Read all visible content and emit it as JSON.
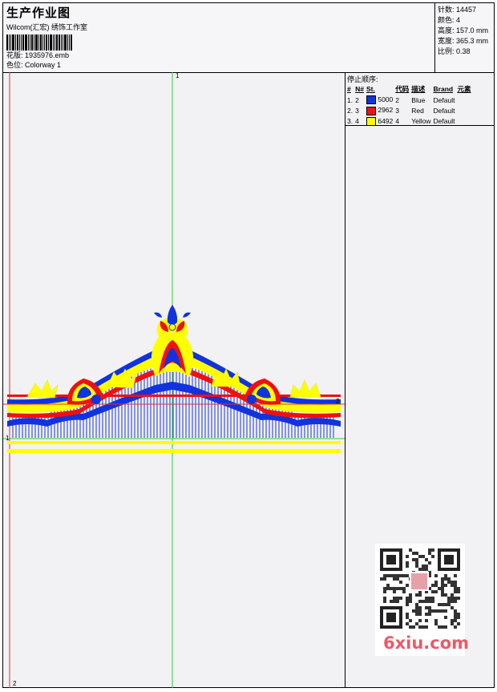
{
  "header": {
    "title": "生产作业图",
    "company": "Wilcom(汇宏) 绣饰工作室",
    "design_label": "花版: 1935976.emb",
    "colorway_label": "色位: Colorway 1"
  },
  "specs": [
    {
      "label": "针数:",
      "value": "14457"
    },
    {
      "label": "颜色:",
      "value": "4"
    },
    {
      "label": "高度:",
      "value": "157.0 mm"
    },
    {
      "label": "宽度:",
      "value": "365.3 mm"
    },
    {
      "label": "比例:",
      "value": "0.38"
    }
  ],
  "stop_sequence": {
    "title": "停止顺序:",
    "columns": [
      "#",
      "N#",
      "St.",
      "代码",
      "描述",
      "Brand",
      "元素"
    ],
    "rows": [
      {
        "num": "1.",
        "needle": "2",
        "code": "5000",
        "code_num": "2",
        "desc": "Blue",
        "brand": "Default",
        "color": "#1133dd"
      },
      {
        "num": "2.",
        "needle": "3",
        "code": "2962",
        "code_num": "3",
        "desc": "Red",
        "brand": "Default",
        "color": "#ee1111"
      },
      {
        "num": "3.",
        "needle": "4",
        "code": "6492",
        "code_num": "4",
        "desc": "Yellow",
        "brand": "Default",
        "color": "#ffff00"
      }
    ]
  },
  "markers": {
    "top": "1",
    "right": "2",
    "left": "1",
    "bottom": "2"
  },
  "watermark": "6xiu.com",
  "colors": {
    "blue": "#1133dd",
    "red": "#ee1111",
    "yellow": "#ffff00",
    "guide_green": "#33cc33",
    "guide_red": "#dd3333"
  }
}
